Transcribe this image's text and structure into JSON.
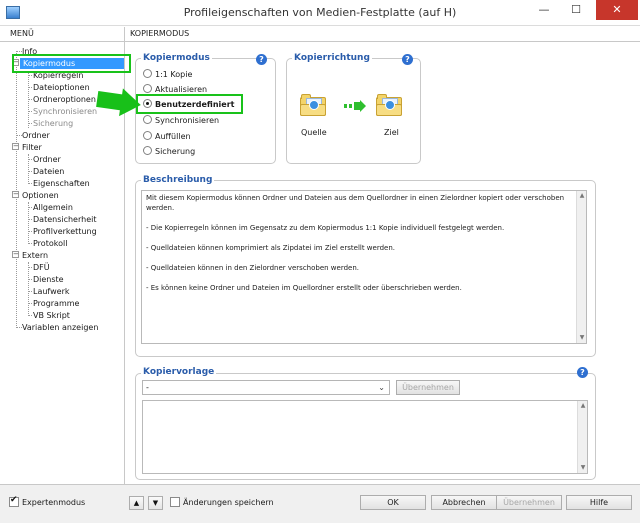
{
  "window": {
    "title": "Profileigenschaften von Medien-Festplatte (auf H)",
    "minimize": "—",
    "maximize": "☐",
    "close": "✕"
  },
  "menu_header": "MENÜ",
  "content_header": "KOPIERMODUS",
  "tree": {
    "info": "Info",
    "kopiermodus": "Kopiermodus",
    "kopierregeln": "Kopierregeln",
    "dateioptionen": "Dateioptionen",
    "ordneroptionen": "Ordneroptionen",
    "synchronisieren": "Synchronisieren",
    "sicherung": "Sicherung",
    "ordner": "Ordner",
    "filter": "Filter",
    "filter_ordner": "Ordner",
    "filter_dateien": "Dateien",
    "filter_eigenschaften": "Eigenschaften",
    "optionen": "Optionen",
    "allgemein": "Allgemein",
    "datensicherheit": "Datensicherheit",
    "profilverkettung": "Profilverkettung",
    "protokoll": "Protokoll",
    "extern": "Extern",
    "dfu": "DFÜ",
    "dienste": "Dienste",
    "laufwerk": "Laufwerk",
    "programme": "Programme",
    "vbskript": "VB Skript",
    "variablen": "Variablen anzeigen"
  },
  "kopiermodus": {
    "title": "Kopiermodus",
    "help": "?",
    "options": {
      "kopie": "1:1 Kopie",
      "aktualisieren": "Aktualisieren",
      "benutzerdefiniert": "Benutzerdefiniert",
      "synchronisieren": "Synchronisieren",
      "auffuellen": "Auffüllen",
      "sicherung": "Sicherung"
    },
    "selected": "Benutzerdefiniert"
  },
  "kopierrichtung": {
    "title": "Kopierrichtung",
    "help": "?",
    "quelle": "Quelle",
    "ziel": "Ziel"
  },
  "beschreibung": {
    "title": "Beschreibung",
    "lines": {
      "l1": "Mit diesem Kopiermodus können Ordner und Dateien aus dem Quellordner in einen Zielordner kopiert oder verschoben",
      "l2": "werden.",
      "l3": "- Die Kopierregeln können im Gegensatz zu dem Kopiermodus 1:1 Kopie individuell festgelegt werden.",
      "l4": "- Quelldateien können komprimiert als Zipdatei im Ziel erstellt werden.",
      "l5": "- Quelldateien können in den Zielordner verschoben werden.",
      "l6": "- Es können keine Ordner und Dateien im Quellordner erstellt oder überschrieben werden."
    }
  },
  "kopiervorlage": {
    "title": "Kopiervorlage",
    "help": "?",
    "select_value": "-",
    "uebernehmen": "Übernehmen"
  },
  "footer": {
    "expertenmodus": "Expertenmodus",
    "expertenmodus_checked": true,
    "up": "▲",
    "down": "▼",
    "aenderungen": "Änderungen speichern",
    "ok": "OK",
    "abbrechen": "Abbrechen",
    "uebernehmen": "Übernehmen",
    "hilfe": "Hilfe"
  },
  "colors": {
    "highlight": "#19c21a",
    "accent": "#2a5caa",
    "selection": "#3399ff"
  }
}
